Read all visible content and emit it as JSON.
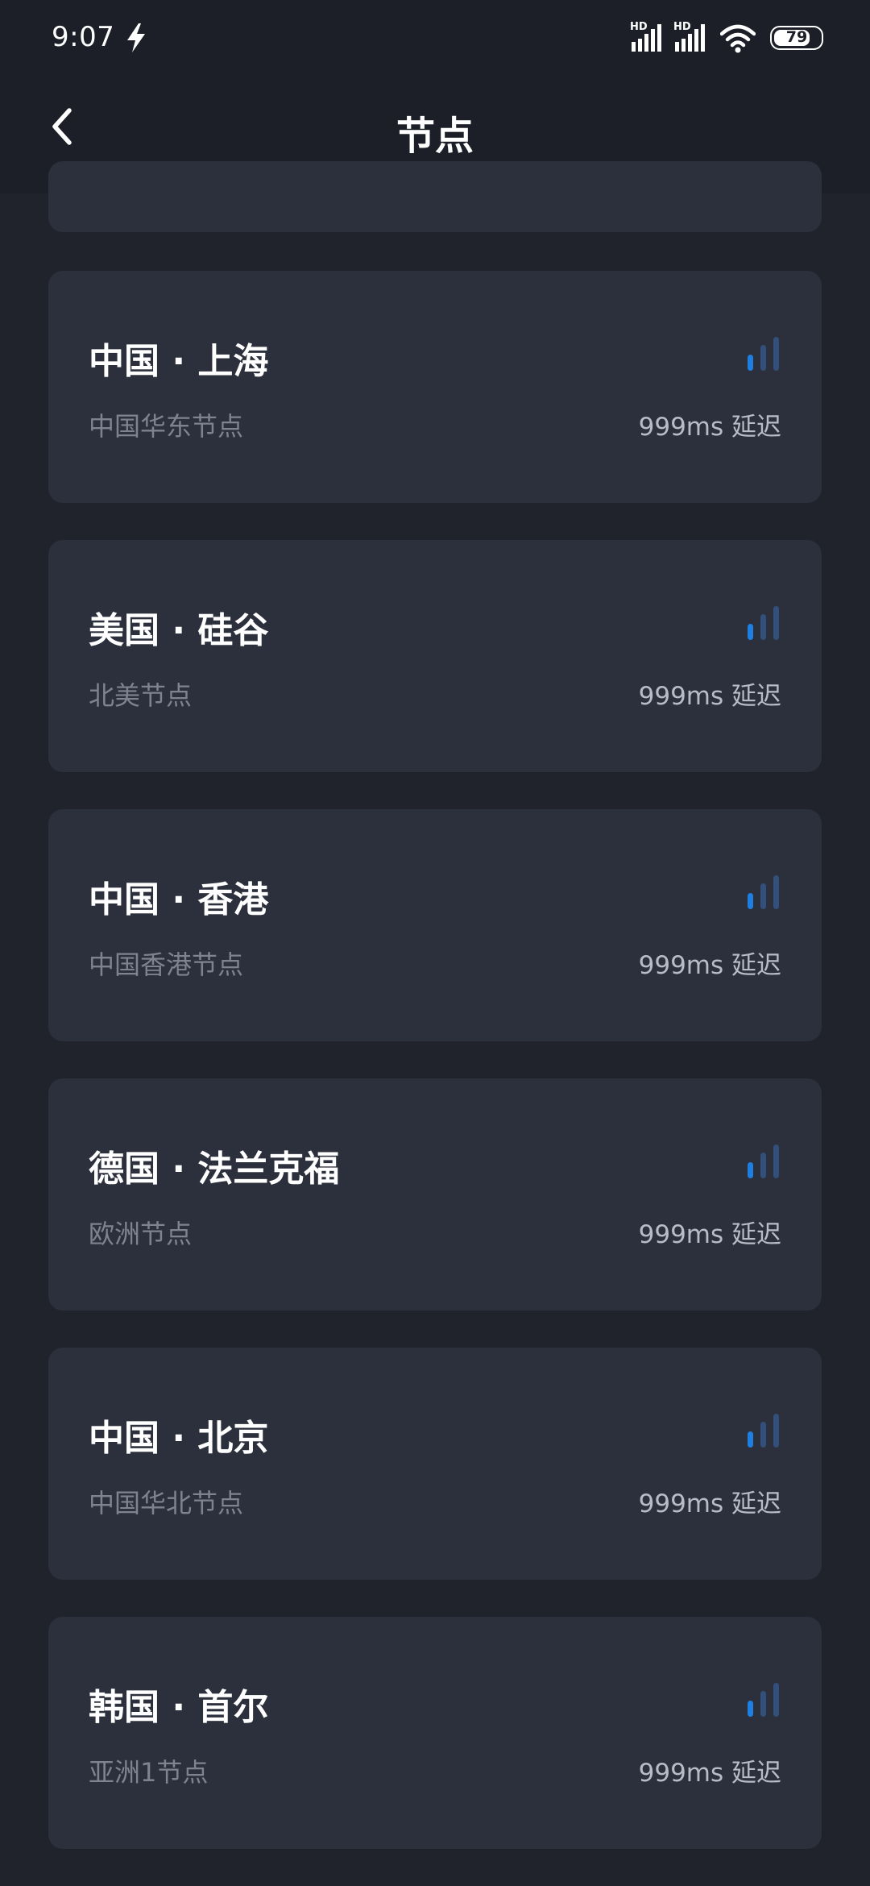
{
  "status_bar": {
    "time": "9:07",
    "battery": "79",
    "battery_level_fraction": 0.79,
    "hd_label_1": "HD",
    "hd_label_2": "HD"
  },
  "header": {
    "title": "节点"
  },
  "colors": {
    "background": "#20232c",
    "header": "#1c1f27",
    "card": "#2c303c",
    "signal_active": "#1f7fe0",
    "signal_inactive": "#32507a"
  },
  "nodes": [
    {
      "title": "中国 · 上海",
      "subtitle": "中国华东节点",
      "latency": "999ms 延迟"
    },
    {
      "title": "美国 · 硅谷",
      "subtitle": "北美节点",
      "latency": "999ms 延迟"
    },
    {
      "title": "中国 · 香港",
      "subtitle": "中国香港节点",
      "latency": "999ms 延迟"
    },
    {
      "title": "德国 · 法兰克福",
      "subtitle": "欧洲节点",
      "latency": "999ms 延迟"
    },
    {
      "title": "中国 · 北京",
      "subtitle": "中国华北节点",
      "latency": "999ms 延迟"
    },
    {
      "title": "韩国 · 首尔",
      "subtitle": "亚洲1节点",
      "latency": "999ms 延迟"
    }
  ]
}
